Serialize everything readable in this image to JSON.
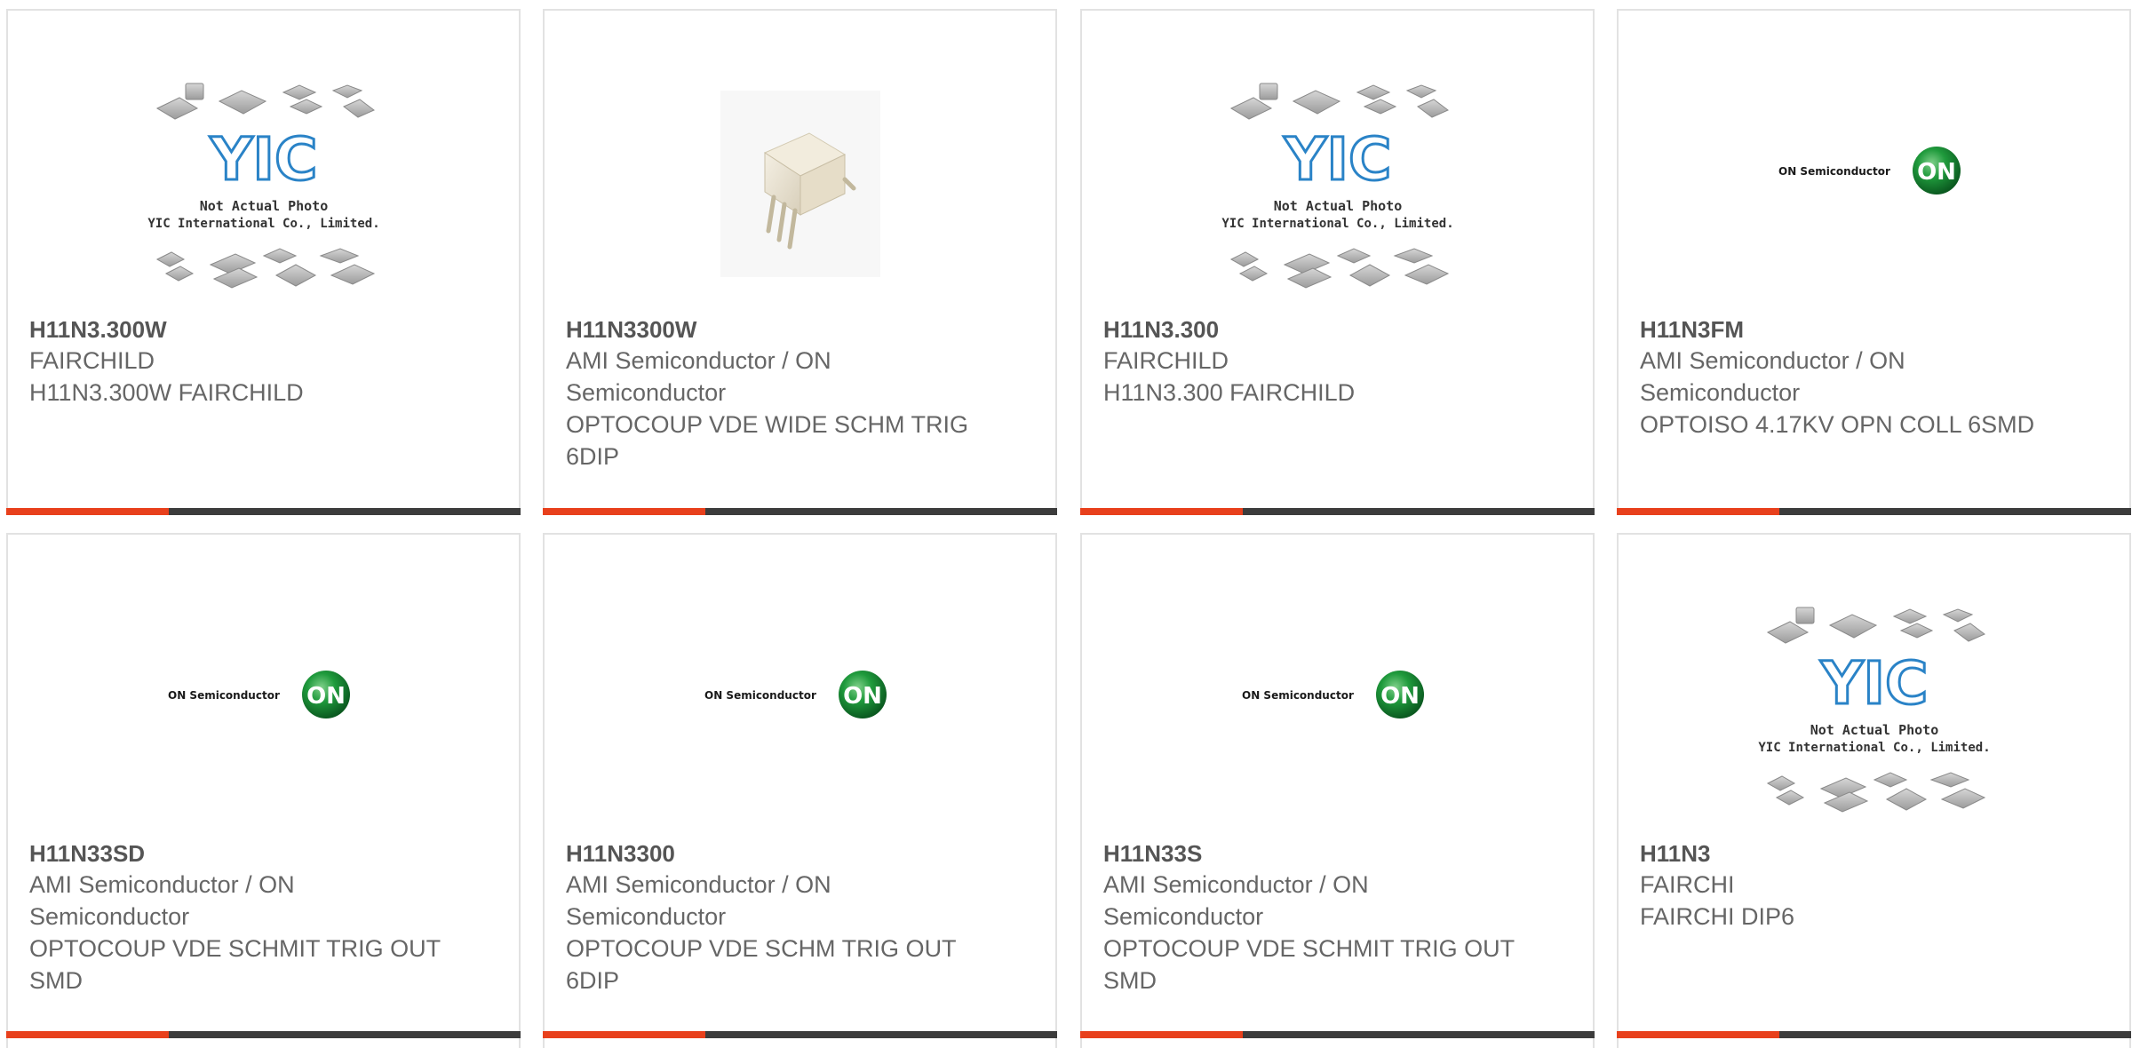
{
  "brand": {
    "accent_color": "#e8401c",
    "bar_color": "#3c3c3c",
    "text_color": "#666666"
  },
  "image_text": {
    "yic_logo": "YIC",
    "yic_caption_1": "Not Actual Photo",
    "yic_caption_2": "YIC International Co., Limited.",
    "on_brand": "ON Semiconductor",
    "on_badge": "ON"
  },
  "products": [
    {
      "image": "yic-placeholder",
      "part": "H11N3.300W",
      "maker": "FAIRCHILD",
      "desc": "H11N3.300W FAIRCHILD"
    },
    {
      "image": "optocoupler-6dip-photo",
      "part": "H11N3300W",
      "maker": "AMI Semiconductor / ON Semiconductor",
      "desc": "OPTOCOUP VDE WIDE SCHM TRIG 6DIP"
    },
    {
      "image": "yic-placeholder",
      "part": "H11N3.300",
      "maker": "FAIRCHILD",
      "desc": "H11N3.300 FAIRCHILD"
    },
    {
      "image": "on-semiconductor-logo",
      "part": "H11N3FM",
      "maker": "AMI Semiconductor / ON Semiconductor",
      "desc": "OPTOISO 4.17KV OPN COLL 6SMD"
    },
    {
      "image": "on-semiconductor-logo",
      "part": "H11N33SD",
      "maker": "AMI Semiconductor / ON Semiconductor",
      "desc": "OPTOCOUP VDE SCHMIT TRIG OUT SMD"
    },
    {
      "image": "on-semiconductor-logo",
      "part": "H11N3300",
      "maker": "AMI Semiconductor / ON Semiconductor",
      "desc": "OPTOCOUP VDE SCHM TRIG OUT 6DIP"
    },
    {
      "image": "on-semiconductor-logo",
      "part": "H11N33S",
      "maker": "AMI Semiconductor / ON Semiconductor",
      "desc": "OPTOCOUP VDE SCHMIT TRIG OUT SMD"
    },
    {
      "image": "yic-placeholder",
      "part": "H11N3",
      "maker": "FAIRCHI",
      "desc": "FAIRCHI DIP6"
    }
  ]
}
